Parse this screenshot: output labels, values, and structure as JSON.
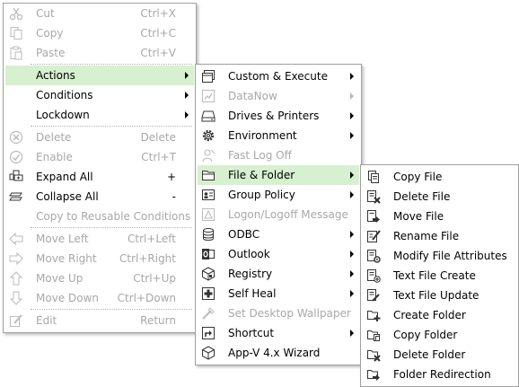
{
  "main_menu": [
    {
      "label": "Cut",
      "shortcut": "Ctrl+X",
      "icon": "scissors-icon",
      "disabled": true
    },
    {
      "label": "Copy",
      "shortcut": "Ctrl+C",
      "icon": "copy-icon",
      "disabled": true
    },
    {
      "label": "Paste",
      "shortcut": "Ctrl+V",
      "icon": "paste-icon",
      "disabled": true
    },
    {
      "label": "Actions",
      "submenu": true,
      "highlighted": true
    },
    {
      "label": "Conditions",
      "submenu": true
    },
    {
      "label": "Lockdown",
      "submenu": true
    },
    {
      "label": "Delete",
      "shortcut": "Delete",
      "icon": "delete-circle-icon",
      "disabled": true
    },
    {
      "label": "Enable",
      "shortcut": "Ctrl+T",
      "icon": "enable-check-icon",
      "disabled": true
    },
    {
      "label": "Expand All",
      "shortcut": "+",
      "icon": "expand-all-icon"
    },
    {
      "label": "Collapse All",
      "shortcut": "-",
      "icon": "collapse-all-icon"
    },
    {
      "label": "Copy to Reusable Conditions",
      "disabled": true
    },
    {
      "label": "Move Left",
      "shortcut": "Ctrl+Left",
      "icon": "arrow-left-icon",
      "disabled": true
    },
    {
      "label": "Move Right",
      "shortcut": "Ctrl+Right",
      "icon": "arrow-right-icon",
      "disabled": true
    },
    {
      "label": "Move Up",
      "shortcut": "Ctrl+Up",
      "icon": "arrow-up-icon",
      "disabled": true
    },
    {
      "label": "Move Down",
      "shortcut": "Ctrl+Down",
      "icon": "arrow-down-icon",
      "disabled": true
    },
    {
      "label": "Edit",
      "shortcut": "Return",
      "icon": "edit-icon",
      "disabled": true
    }
  ],
  "actions_menu": [
    {
      "label": "Custom & Execute",
      "icon": "custom-execute-icon",
      "submenu": true
    },
    {
      "label": "DataNow",
      "icon": "datanow-icon",
      "submenu": true,
      "disabled": true
    },
    {
      "label": "Drives & Printers",
      "icon": "drive-icon",
      "submenu": true
    },
    {
      "label": "Environment",
      "icon": "gear-icon",
      "submenu": true
    },
    {
      "label": "Fast Log Off",
      "icon": "fast-log-off-icon",
      "disabled": true
    },
    {
      "label": "File & Folder",
      "icon": "folder-icon",
      "submenu": true,
      "highlighted": true
    },
    {
      "label": "Group Policy",
      "icon": "group-policy-icon",
      "submenu": true
    },
    {
      "label": "Logon/Logoff Message",
      "icon": "message-icon",
      "disabled": true
    },
    {
      "label": "ODBC",
      "icon": "database-icon",
      "submenu": true
    },
    {
      "label": "Outlook",
      "icon": "outlook-icon",
      "submenu": true
    },
    {
      "label": "Registry",
      "icon": "registry-icon",
      "submenu": true
    },
    {
      "label": "Self Heal",
      "icon": "self-heal-icon",
      "submenu": true
    },
    {
      "label": "Set Desktop Wallpaper",
      "icon": "wallpaper-icon",
      "disabled": true
    },
    {
      "label": "Shortcut",
      "icon": "shortcut-icon",
      "submenu": true
    },
    {
      "label": "App-V 4.x Wizard",
      "icon": "cube-icon"
    }
  ],
  "file_folder_menu": [
    {
      "label": "Copy File",
      "icon": "copy-file-icon"
    },
    {
      "label": "Delete File",
      "icon": "delete-file-icon"
    },
    {
      "label": "Move File",
      "icon": "move-file-icon"
    },
    {
      "label": "Rename File",
      "icon": "rename-file-icon"
    },
    {
      "label": "Modify File Attributes",
      "icon": "file-attributes-icon"
    },
    {
      "label": "Text File Create",
      "icon": "text-file-create-icon"
    },
    {
      "label": "Text File Update",
      "icon": "text-file-update-icon"
    },
    {
      "label": "Create Folder",
      "icon": "create-folder-icon"
    },
    {
      "label": "Copy Folder",
      "icon": "copy-folder-icon"
    },
    {
      "label": "Delete Folder",
      "icon": "delete-folder-icon"
    },
    {
      "label": "Folder Redirection",
      "icon": "folder-redirection-icon"
    }
  ],
  "colors": {
    "highlight": "#d7f0d0",
    "disabled_text": "#a8a8a8",
    "border": "#a0a0a0"
  }
}
